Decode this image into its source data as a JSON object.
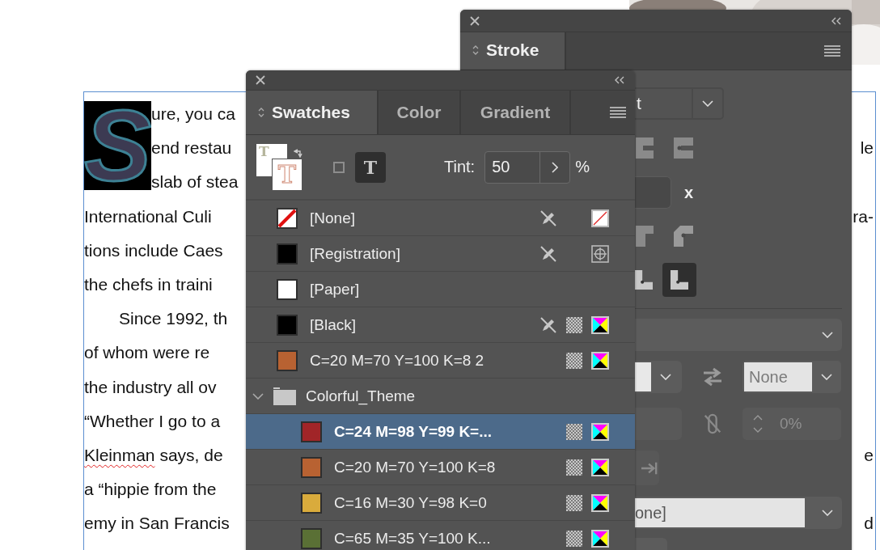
{
  "document": {
    "drop_cap": "S",
    "lines": [
      {
        "text": "ure, you ca",
        "indent": false
      },
      {
        "text": "end restau",
        "indent": false,
        "right": "le"
      },
      {
        "text": "slab of stea",
        "indent": false
      },
      {
        "text": "International Culi",
        "indent": false,
        "right": "ra-"
      },
      {
        "text": "tions include Caes",
        "indent": false
      },
      {
        "text": "the chefs in traini",
        "indent": false
      },
      {
        "text": "Since 1992, th",
        "indent": true
      },
      {
        "text": "of whom were re",
        "indent": false
      },
      {
        "text": "the industry all ov",
        "indent": false
      },
      {
        "text": "“Whether I go to a",
        "indent": false
      },
      {
        "parts": [
          {
            "text": "Kleinman",
            "misspelled": true
          },
          {
            "text": " says, de",
            "misspelled": false
          }
        ],
        "indent": false,
        "right": "e"
      },
      {
        "text": "a “hippie from the",
        "indent": false
      },
      {
        "text": "emy in San Francis",
        "indent": false,
        "right": "d"
      }
    ]
  },
  "stroke_panel": {
    "tab": {
      "label": "Stroke",
      "selected": true
    },
    "weight_value": "t",
    "miter_label": "x",
    "align_options": [
      {
        "selected": false
      },
      {
        "selected": true
      }
    ],
    "end_value": "None",
    "scale_value": "0%",
    "arrowhead_value": "one]"
  },
  "swatches_panel": {
    "tabs": [
      {
        "label": "Swatches",
        "selected": true
      },
      {
        "label": "Color",
        "selected": false
      },
      {
        "label": "Gradient",
        "selected": false
      }
    ],
    "fill_letter": "T",
    "stroke_letter": "T",
    "formatting": [
      {
        "kind": "container",
        "selected": false
      },
      {
        "kind": "text",
        "label": "T",
        "selected": true
      }
    ],
    "tint_label": "Tint:",
    "tint_value": "50",
    "tint_unit": "%",
    "swatches": [
      {
        "kind": "none",
        "name": "[None]",
        "non_editable": true,
        "process": false,
        "mode": {
          "kind": "none"
        },
        "selected": false
      },
      {
        "kind": "solid",
        "name": "[Registration]",
        "color": "#000000",
        "non_editable": true,
        "process": false,
        "mode": {
          "kind": "registration"
        },
        "selected": false
      },
      {
        "kind": "solid",
        "name": "[Paper]",
        "color": "#ffffff",
        "non_editable": false,
        "process": false,
        "selected": false
      },
      {
        "kind": "solid",
        "name": "[Black]",
        "color": "#000000",
        "non_editable": true,
        "process": true,
        "mode": {
          "kind": "cmyk"
        },
        "selected": false
      },
      {
        "kind": "solid",
        "name": "C=20 M=70 Y=100 K=8 2",
        "color": "#b86232",
        "non_editable": false,
        "process": true,
        "mode": {
          "kind": "cmyk"
        },
        "selected": false
      },
      {
        "kind": "group",
        "name": "Colorful_Theme",
        "expanded": true,
        "selected": false,
        "children": [
          {
            "kind": "solid",
            "name": "C=24 M=98 Y=99 K=...",
            "color": "#a12528",
            "non_editable": false,
            "process": true,
            "mode": {
              "kind": "cmyk"
            },
            "selected": true
          },
          {
            "kind": "solid",
            "name": "C=20 M=70 Y=100 K=8",
            "color": "#b86232",
            "non_editable": false,
            "process": true,
            "mode": {
              "kind": "cmyk"
            },
            "selected": false
          },
          {
            "kind": "solid",
            "name": "C=16 M=30 Y=98 K=0",
            "color": "#d9ab3c",
            "non_editable": false,
            "process": true,
            "mode": {
              "kind": "cmyk"
            },
            "selected": false
          },
          {
            "kind": "solid",
            "name": "C=65 M=35 Y=100 K...",
            "color": "#5a7035",
            "non_editable": false,
            "process": true,
            "mode": {
              "kind": "cmyk"
            },
            "selected": false
          }
        ]
      }
    ]
  }
}
